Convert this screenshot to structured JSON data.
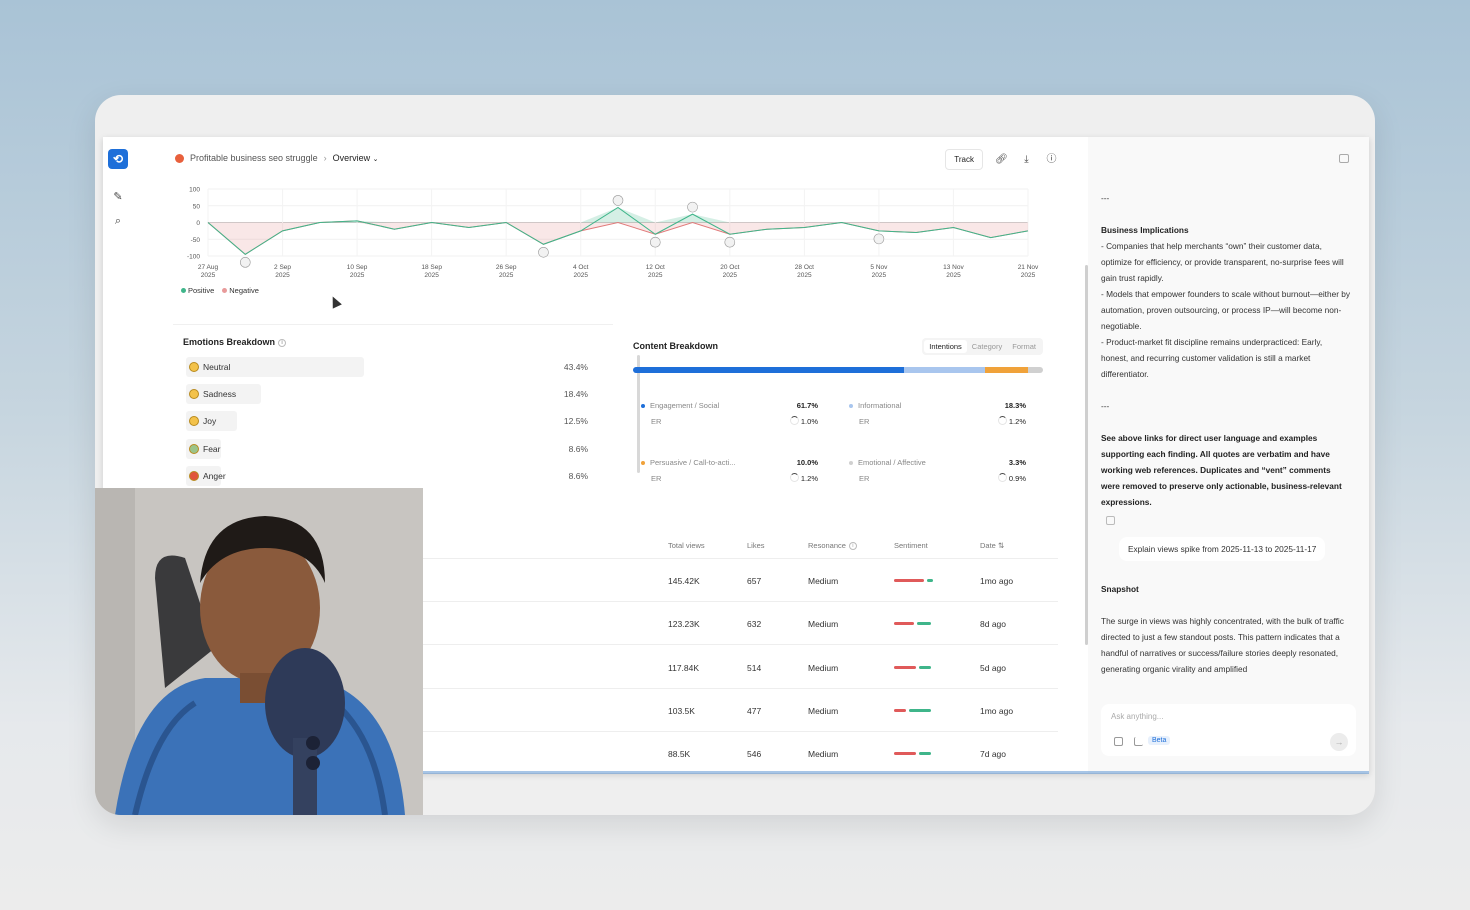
{
  "breadcrumb": {
    "project": "Profitable business seo struggle",
    "view": "Overview"
  },
  "toolbar": {
    "track_label": "Track"
  },
  "sentiment_chart": {
    "y_ticks": [
      "100",
      "50",
      "0",
      "-50",
      "-100"
    ],
    "x_ticks": [
      {
        "d": "27 Aug",
        "y": "2025"
      },
      {
        "d": "2 Sep",
        "y": "2025"
      },
      {
        "d": "10 Sep",
        "y": "2025"
      },
      {
        "d": "18 Sep",
        "y": "2025"
      },
      {
        "d": "26 Sep",
        "y": "2025"
      },
      {
        "d": "4 Oct",
        "y": "2025"
      },
      {
        "d": "12 Oct",
        "y": "2025"
      },
      {
        "d": "20 Oct",
        "y": "2025"
      },
      {
        "d": "28 Oct",
        "y": "2025"
      },
      {
        "d": "5 Nov",
        "y": "2025"
      },
      {
        "d": "13 Nov",
        "y": "2025"
      },
      {
        "d": "21 Nov",
        "y": "2025"
      }
    ],
    "legend": {
      "positive": "Positive",
      "negative": "Negative"
    },
    "colors": {
      "positive": "#3fb58a",
      "negative": "#e07a7a"
    }
  },
  "chart_data": {
    "type": "line",
    "title": "",
    "ylim": [
      -100,
      100
    ],
    "x": [
      "27 Aug",
      "31 Aug",
      "2 Sep",
      "6 Sep",
      "10 Sep",
      "14 Sep",
      "18 Sep",
      "22 Sep",
      "26 Sep",
      "30 Sep",
      "4 Oct",
      "8 Oct",
      "12 Oct",
      "16 Oct",
      "20 Oct",
      "24 Oct",
      "28 Oct",
      "1 Nov",
      "5 Nov",
      "9 Nov",
      "13 Nov",
      "17 Nov",
      "21 Nov"
    ],
    "series": [
      {
        "name": "Positive",
        "values": [
          0,
          -95,
          -25,
          0,
          5,
          -20,
          0,
          -15,
          0,
          -65,
          -25,
          45,
          -35,
          25,
          -35,
          -20,
          -15,
          0,
          -25,
          -30,
          -15,
          -45,
          -25
        ]
      },
      {
        "name": "Negative",
        "values": [
          0,
          -95,
          -25,
          0,
          5,
          -20,
          0,
          -15,
          0,
          -65,
          -25,
          0,
          -35,
          0,
          -35,
          -20,
          -15,
          0,
          -25,
          -30,
          -15,
          -45,
          -25
        ]
      }
    ]
  },
  "emotions": {
    "title": "Emotions Breakdown",
    "items": [
      {
        "label": "Neutral",
        "value": "43.4%",
        "fill": 0.434,
        "color": "#f3c24a"
      },
      {
        "label": "Sadness",
        "value": "18.4%",
        "fill": 0.184,
        "color": "#f3c24a"
      },
      {
        "label": "Joy",
        "value": "12.5%",
        "fill": 0.125,
        "color": "#f3c24a"
      },
      {
        "label": "Fear",
        "value": "8.6%",
        "fill": 0.086,
        "color": "#9bc48a"
      },
      {
        "label": "Anger",
        "value": "8.6%",
        "fill": 0.086,
        "color": "#e0553a"
      }
    ]
  },
  "content": {
    "title": "Content Breakdown",
    "tabs": [
      "Intentions",
      "Category",
      "Format"
    ],
    "segments": [
      {
        "name": "Engagement / Social",
        "share": 0.617,
        "color": "#1e6fd9"
      },
      {
        "name": "Informational",
        "share": 0.183,
        "color": "#a9c6ee"
      },
      {
        "name": "Persuasive / Call-to-acti...",
        "share": 0.1,
        "color": "#f0a23a"
      },
      {
        "name": "Emotional / Affective",
        "share": 0.033,
        "color": "#d0d0d0"
      }
    ],
    "tiles": [
      {
        "name": "Engagement / Social",
        "pct": "61.7%",
        "er_label": "ER",
        "er": "1.0%",
        "dot": "#1e6fd9"
      },
      {
        "name": "Informational",
        "pct": "18.3%",
        "er_label": "ER",
        "er": "1.2%",
        "dot": "#a9c6ee"
      },
      {
        "name": "Persuasive / Call-to-acti...",
        "pct": "10.0%",
        "er_label": "ER",
        "er": "1.2%",
        "dot": "#f0a23a"
      },
      {
        "name": "Emotional / Affective",
        "pct": "3.3%",
        "er_label": "ER",
        "er": "0.9%",
        "dot": "#d0d0d0"
      }
    ]
  },
  "table": {
    "headers": {
      "views": "Total views",
      "likes": "Likes",
      "resonance": "Resonance",
      "sentiment": "Sentiment",
      "date": "Date"
    },
    "rows": [
      {
        "views": "145.42K",
        "likes": "657",
        "resonance": "Medium",
        "neg": 0.75,
        "pos": 0.15,
        "date": "1mo ago"
      },
      {
        "views": "123.23K",
        "likes": "632",
        "resonance": "Medium",
        "neg": 0.5,
        "pos": 0.35,
        "date": "8d ago"
      },
      {
        "views": "117.84K",
        "likes": "514",
        "resonance": "Medium",
        "neg": 0.55,
        "pos": 0.3,
        "date": "5d ago"
      },
      {
        "views": "103.5K",
        "likes": "477",
        "resonance": "Medium",
        "neg": 0.3,
        "pos": 0.55,
        "date": "1mo ago"
      },
      {
        "views": "88.5K",
        "likes": "546",
        "resonance": "Medium",
        "neg": 0.55,
        "pos": 0.3,
        "date": "7d ago"
      }
    ]
  },
  "panel": {
    "sep1": "---",
    "implications_title": "Business Implications",
    "implications": [
      "- Companies that help merchants “own” their customer data, optimize for efficiency, or provide transparent, no-surprise fees will gain trust rapidly.",
      "- Models that empower founders to scale without burnout—either by automation, proven outsourcing, or process IP—will become non-negotiable.",
      "- Product-market fit discipline remains underpracticed: Early, honest, and recurring customer validation is still a market differentiator."
    ],
    "sep2": "---",
    "note": "See above links for direct user language and examples supporting each finding. All quotes are verbatim and have working web references. Duplicates and “vent” comments were removed to preserve only actionable, business-relevant expressions.",
    "user_message": "Explain views spike from 2025-11-13 to 2025-11-17",
    "snapshot_title": "Snapshot",
    "snapshot": "The surge in views was highly concentrated, with the bulk of traffic directed to just a few standout posts. This pattern indicates that a handful of narratives or success/failure stories deeply resonated, generating organic virality and amplified",
    "composer_placeholder": "Ask anything...",
    "beta": "Beta"
  }
}
